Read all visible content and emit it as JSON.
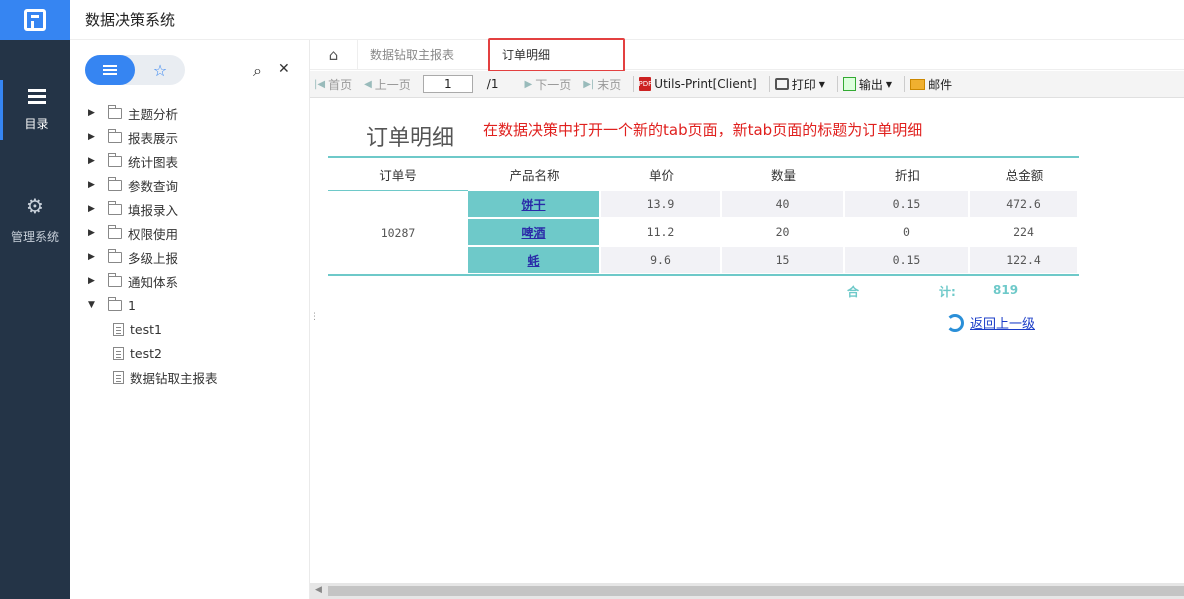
{
  "app": {
    "title": "数据决策系统"
  },
  "nav": {
    "items": [
      {
        "label": "目录",
        "icon": "list-icon",
        "active": true
      },
      {
        "label": "管理系统",
        "icon": "gear-icon",
        "active": false
      }
    ]
  },
  "sidebar": {
    "tree": [
      {
        "label": "主题分析",
        "type": "folder",
        "expanded": false
      },
      {
        "label": "报表展示",
        "type": "folder",
        "expanded": false
      },
      {
        "label": "统计图表",
        "type": "folder",
        "expanded": false
      },
      {
        "label": "参数查询",
        "type": "folder",
        "expanded": false
      },
      {
        "label": "填报录入",
        "type": "folder",
        "expanded": false
      },
      {
        "label": "权限使用",
        "type": "folder",
        "expanded": false
      },
      {
        "label": "多级上报",
        "type": "folder",
        "expanded": false
      },
      {
        "label": "通知体系",
        "type": "folder",
        "expanded": false
      },
      {
        "label": "1",
        "type": "folder",
        "expanded": true
      },
      {
        "label": "test1",
        "type": "file"
      },
      {
        "label": "test2",
        "type": "file"
      },
      {
        "label": "数据钻取主报表",
        "type": "file"
      }
    ]
  },
  "tabs": [
    {
      "label": "数据钻取主报表",
      "active": false
    },
    {
      "label": "订单明细",
      "active": true
    }
  ],
  "toolbar": {
    "first": "首页",
    "prev": "上一页",
    "page_value": "1",
    "page_total": "/1",
    "next": "下一页",
    "last": "末页",
    "print_client": "Utils-Print[Client]",
    "print": "打印",
    "export": "输出",
    "mail": "邮件"
  },
  "annotation": "在数据决策中打开一个新的tab页面，新tab页面的标题为订单明细",
  "report": {
    "title": "订单明细",
    "headers": [
      "订单号",
      "产品名称",
      "单价",
      "数量",
      "折扣",
      "总金额"
    ],
    "order_id": "10287",
    "rows": [
      {
        "product": "饼干",
        "price": "13.9",
        "qty": "40",
        "discount": "0.15",
        "total": "472.6"
      },
      {
        "product": "啤酒",
        "price": "11.2",
        "qty": "20",
        "discount": "0",
        "total": "224"
      },
      {
        "product": "蚝",
        "price": "9.6",
        "qty": "15",
        "discount": "0.15",
        "total": "122.4"
      }
    ],
    "total_label_1": "合",
    "total_label_2": "计:",
    "total_value": "819",
    "back_link": "返回上一级"
  }
}
